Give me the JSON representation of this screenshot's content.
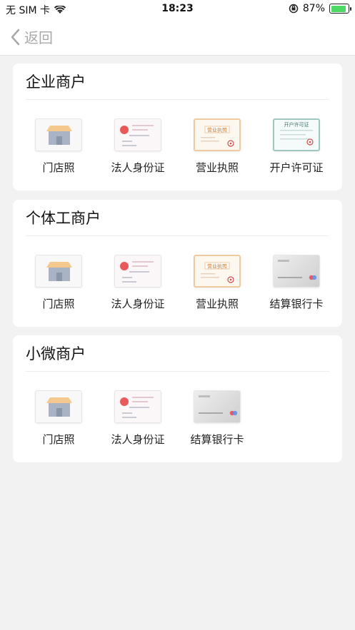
{
  "status": {
    "carrier": "无 SIM 卡",
    "time": "18:23",
    "battery_percent": "87%",
    "battery_level": 0.87
  },
  "nav": {
    "back_label": "返回"
  },
  "sections": [
    {
      "title": "企业商户",
      "items": [
        {
          "label": "门店照",
          "icon": "storefront-photo-icon"
        },
        {
          "label": "法人身份证",
          "icon": "id-card-icon"
        },
        {
          "label": "营业执照",
          "icon": "business-license-icon"
        },
        {
          "label": "开户许可证",
          "icon": "account-permit-icon"
        }
      ]
    },
    {
      "title": "个体工商户",
      "items": [
        {
          "label": "门店照",
          "icon": "storefront-photo-icon"
        },
        {
          "label": "法人身份证",
          "icon": "id-card-icon"
        },
        {
          "label": "营业执照",
          "icon": "business-license-icon"
        },
        {
          "label": "结算银行卡",
          "icon": "bank-card-icon"
        }
      ]
    },
    {
      "title": "小微商户",
      "items": [
        {
          "label": "门店照",
          "icon": "storefront-photo-icon"
        },
        {
          "label": "法人身份证",
          "icon": "id-card-icon"
        },
        {
          "label": "结算银行卡",
          "icon": "bank-card-icon"
        }
      ]
    }
  ],
  "colors": {
    "background": "#f2f2f2",
    "card": "#ffffff",
    "back_text": "#a9a9a9",
    "battery": "#4cd964"
  }
}
